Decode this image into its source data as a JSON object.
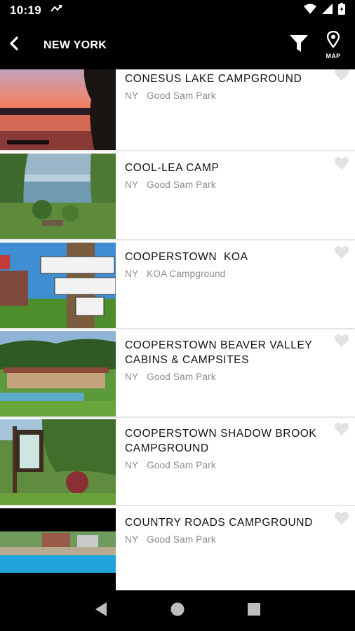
{
  "status": {
    "time": "10:19",
    "icons": [
      "sync-icon",
      "wifi-icon",
      "signal-icon",
      "battery-icon"
    ]
  },
  "header": {
    "title": "NEW YORK",
    "back_icon": "chevron-left-icon",
    "filter_icon": "filter-icon",
    "map_icon": "map-pin-icon",
    "map_label": "MAP"
  },
  "campgrounds": [
    {
      "name": "CONESUS LAKE CAMPGROUND",
      "state": "NY",
      "type": "Good Sam Park",
      "image": "sunset-lake"
    },
    {
      "name": "COOL-LEA CAMP",
      "state": "NY",
      "type": "Good Sam Park",
      "image": "lakeside-trees"
    },
    {
      "name": "COOPERSTOWN  KOA",
      "state": "NY",
      "type": "KOA Campground",
      "image": "street-signs"
    },
    {
      "name": "COOPERSTOWN BEAVER VALLEY CABINS & CAMPSITES",
      "state": "NY",
      "type": "Good Sam Park",
      "image": "pavilion-pool"
    },
    {
      "name": "COOPERSTOWN SHADOW BROOK CAMPGROUND",
      "state": "NY",
      "type": "Good Sam Park",
      "image": "entrance-sign"
    },
    {
      "name": "COUNTRY ROADS CAMPGROUND",
      "state": "NY",
      "type": "Good Sam Park",
      "image": "swimming-pool"
    }
  ],
  "colors": {
    "bar": "#000000",
    "text": "#111111",
    "meta": "#8a8a8a",
    "divider": "#e6e6e6"
  }
}
